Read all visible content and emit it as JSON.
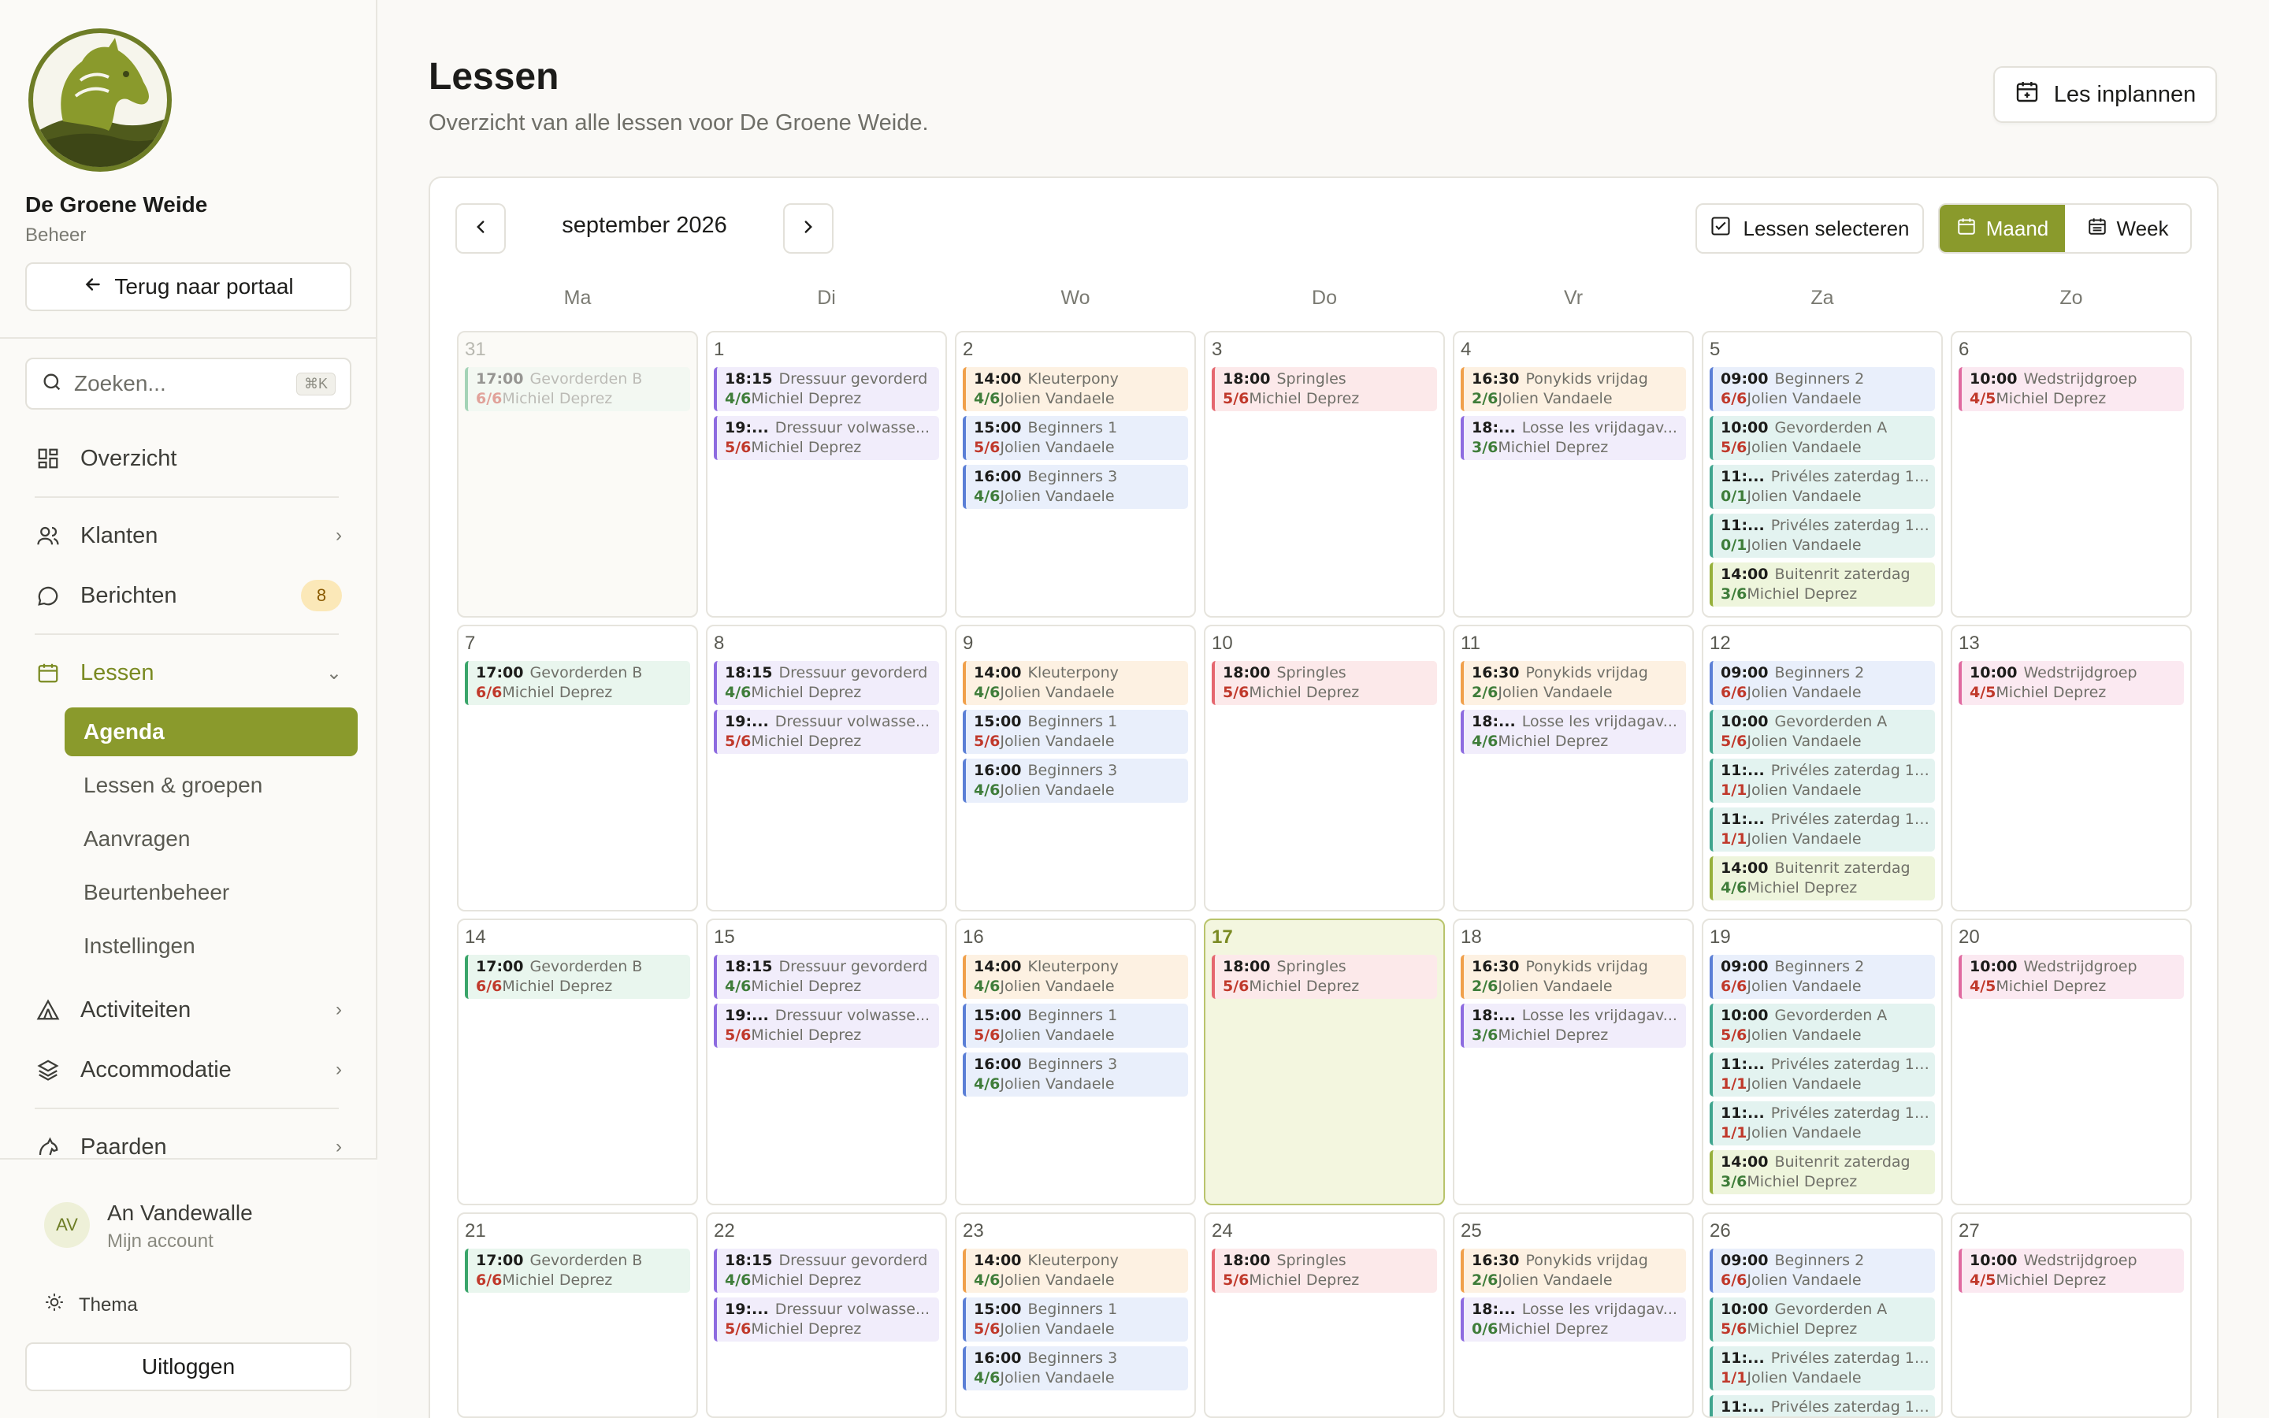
{
  "sidebar": {
    "brand_name": "De Groene Weide",
    "brand_sub": "Beheer",
    "back_label": "Terug naar portaal",
    "search_placeholder": "Zoeken...",
    "search_shortcut": "⌘K",
    "nav": {
      "overzicht": "Overzicht",
      "klanten": "Klanten",
      "berichten": "Berichten",
      "berichten_badge": "8",
      "lessen": "Lessen",
      "activiteiten": "Activiteiten",
      "accommodatie": "Accommodatie",
      "paarden": "Paarden"
    },
    "lessen_sub": {
      "agenda": "Agenda",
      "lessen_groepen": "Lessen & groepen",
      "aanvragen": "Aanvragen",
      "beurtenbeheer": "Beurtenbeheer",
      "instellingen": "Instellingen"
    },
    "user": {
      "initials": "AV",
      "name": "An Vandewalle",
      "sub": "Mijn account"
    },
    "theme_label": "Thema",
    "logout_label": "Uitloggen"
  },
  "header": {
    "title": "Lessen",
    "subtitle": "Overzicht van alle lessen voor De Groene Weide.",
    "plan_button": "Les inplannen"
  },
  "calendar": {
    "month_label": "september 2026",
    "select_button": "Lessen selecteren",
    "view_month": "Maand",
    "view_week": "Week",
    "active_view": "Maand",
    "weekdays": [
      "Ma",
      "Di",
      "Wo",
      "Do",
      "Vr",
      "Za",
      "Zo"
    ],
    "weeks": [
      [
        {
          "day": "31",
          "muted": true,
          "events": [
            {
              "time": "17:00",
              "title": "Gevorderden B",
              "cap": "6/6",
              "who": "Michiel Deprez",
              "color": "green"
            }
          ]
        },
        {
          "day": "1",
          "events": [
            {
              "time": "18:15",
              "title": "Dressuur gevorderd",
              "cap": "4/6",
              "who": "Michiel Deprez",
              "color": "purple"
            },
            {
              "time": "19:...",
              "title": "Dressuur volwasse...",
              "cap": "5/6",
              "who": "Michiel Deprez",
              "color": "purple-red"
            }
          ]
        },
        {
          "day": "2",
          "events": [
            {
              "time": "14:00",
              "title": "Kleuterpony",
              "cap": "4/6",
              "who": "Jolien Vandaele",
              "color": "orange"
            },
            {
              "time": "15:00",
              "title": "Beginners 1",
              "cap": "5/6",
              "who": "Jolien Vandaele",
              "color": "blue"
            },
            {
              "time": "16:00",
              "title": "Beginners 3",
              "cap": "4/6",
              "who": "Jolien Vandaele",
              "color": "bluegreen"
            }
          ]
        },
        {
          "day": "3",
          "events": [
            {
              "time": "18:00",
              "title": "Springles",
              "cap": "5/6",
              "who": "Michiel Deprez",
              "color": "red"
            }
          ]
        },
        {
          "day": "4",
          "events": [
            {
              "time": "16:30",
              "title": "Ponykids vrijdag",
              "cap": "2/6",
              "who": "Jolien Vandaele",
              "color": "orange"
            },
            {
              "time": "18:...",
              "title": "Losse les vrijdagav...",
              "cap": "3/6",
              "who": "Michiel Deprez",
              "color": "purple"
            }
          ]
        },
        {
          "day": "5",
          "events": [
            {
              "time": "09:00",
              "title": "Beginners 2",
              "cap": "6/6",
              "who": "Jolien Vandaele",
              "color": "blue"
            },
            {
              "time": "10:00",
              "title": "Gevorderden A",
              "cap": "5/6",
              "who": "Jolien Vandaele",
              "color": "teal-red"
            },
            {
              "time": "11:...",
              "title": "Privéles zaterdag 11...",
              "cap": "0/1",
              "who": "Jolien Vandaele",
              "color": "teal"
            },
            {
              "time": "11:...",
              "title": "Privéles zaterdag 11...",
              "cap": "0/1",
              "who": "Jolien Vandaele",
              "color": "teal"
            },
            {
              "time": "14:00",
              "title": "Buitenrit zaterdag",
              "cap": "3/6",
              "who": "Michiel Deprez",
              "color": "lime"
            }
          ]
        },
        {
          "day": "6",
          "events": [
            {
              "time": "10:00",
              "title": "Wedstrijdgroep",
              "cap": "4/5",
              "who": "Michiel Deprez",
              "color": "pink"
            }
          ]
        }
      ],
      [
        {
          "day": "7",
          "events": [
            {
              "time": "17:00",
              "title": "Gevorderden B",
              "cap": "6/6",
              "who": "Michiel Deprez",
              "color": "green"
            }
          ]
        },
        {
          "day": "8",
          "events": [
            {
              "time": "18:15",
              "title": "Dressuur gevorderd",
              "cap": "4/6",
              "who": "Michiel Deprez",
              "color": "purple"
            },
            {
              "time": "19:...",
              "title": "Dressuur volwasse...",
              "cap": "5/6",
              "who": "Michiel Deprez",
              "color": "purple-red"
            }
          ]
        },
        {
          "day": "9",
          "events": [
            {
              "time": "14:00",
              "title": "Kleuterpony",
              "cap": "4/6",
              "who": "Jolien Vandaele",
              "color": "orange"
            },
            {
              "time": "15:00",
              "title": "Beginners 1",
              "cap": "5/6",
              "who": "Jolien Vandaele",
              "color": "blue"
            },
            {
              "time": "16:00",
              "title": "Beginners 3",
              "cap": "4/6",
              "who": "Jolien Vandaele",
              "color": "bluegreen"
            }
          ]
        },
        {
          "day": "10",
          "events": [
            {
              "time": "18:00",
              "title": "Springles",
              "cap": "5/6",
              "who": "Michiel Deprez",
              "color": "red"
            }
          ]
        },
        {
          "day": "11",
          "events": [
            {
              "time": "16:30",
              "title": "Ponykids vrijdag",
              "cap": "2/6",
              "who": "Jolien Vandaele",
              "color": "orange"
            },
            {
              "time": "18:...",
              "title": "Losse les vrijdagav...",
              "cap": "4/6",
              "who": "Michiel Deprez",
              "color": "purple"
            }
          ]
        },
        {
          "day": "12",
          "events": [
            {
              "time": "09:00",
              "title": "Beginners 2",
              "cap": "6/6",
              "who": "Jolien Vandaele",
              "color": "blue"
            },
            {
              "time": "10:00",
              "title": "Gevorderden A",
              "cap": "5/6",
              "who": "Jolien Vandaele",
              "color": "teal-red"
            },
            {
              "time": "11:...",
              "title": "Privéles zaterdag 11...",
              "cap": "1/1",
              "who": "Jolien Vandaele",
              "color": "teal-red"
            },
            {
              "time": "11:...",
              "title": "Privéles zaterdag 11...",
              "cap": "1/1",
              "who": "Jolien Vandaele",
              "color": "teal-red"
            },
            {
              "time": "14:00",
              "title": "Buitenrit zaterdag",
              "cap": "4/6",
              "who": "Michiel Deprez",
              "color": "lime"
            }
          ]
        },
        {
          "day": "13",
          "events": [
            {
              "time": "10:00",
              "title": "Wedstrijdgroep",
              "cap": "4/5",
              "who": "Michiel Deprez",
              "color": "pink"
            }
          ]
        }
      ],
      [
        {
          "day": "14",
          "events": [
            {
              "time": "17:00",
              "title": "Gevorderden B",
              "cap": "6/6",
              "who": "Michiel Deprez",
              "color": "green"
            }
          ]
        },
        {
          "day": "15",
          "events": [
            {
              "time": "18:15",
              "title": "Dressuur gevorderd",
              "cap": "4/6",
              "who": "Michiel Deprez",
              "color": "purple"
            },
            {
              "time": "19:...",
              "title": "Dressuur volwasse...",
              "cap": "5/6",
              "who": "Michiel Deprez",
              "color": "purple-red"
            }
          ]
        },
        {
          "day": "16",
          "events": [
            {
              "time": "14:00",
              "title": "Kleuterpony",
              "cap": "4/6",
              "who": "Jolien Vandaele",
              "color": "orange"
            },
            {
              "time": "15:00",
              "title": "Beginners 1",
              "cap": "5/6",
              "who": "Jolien Vandaele",
              "color": "blue"
            },
            {
              "time": "16:00",
              "title": "Beginners 3",
              "cap": "4/6",
              "who": "Jolien Vandaele",
              "color": "bluegreen"
            }
          ]
        },
        {
          "day": "17",
          "today": true,
          "events": [
            {
              "time": "18:00",
              "title": "Springles",
              "cap": "5/6",
              "who": "Michiel Deprez",
              "color": "red"
            }
          ]
        },
        {
          "day": "18",
          "events": [
            {
              "time": "16:30",
              "title": "Ponykids vrijdag",
              "cap": "2/6",
              "who": "Jolien Vandaele",
              "color": "orange"
            },
            {
              "time": "18:...",
              "title": "Losse les vrijdagav...",
              "cap": "3/6",
              "who": "Michiel Deprez",
              "color": "purple"
            }
          ]
        },
        {
          "day": "19",
          "events": [
            {
              "time": "09:00",
              "title": "Beginners 2",
              "cap": "6/6",
              "who": "Jolien Vandaele",
              "color": "blue"
            },
            {
              "time": "10:00",
              "title": "Gevorderden A",
              "cap": "5/6",
              "who": "Jolien Vandaele",
              "color": "teal-red"
            },
            {
              "time": "11:...",
              "title": "Privéles zaterdag 11...",
              "cap": "1/1",
              "who": "Jolien Vandaele",
              "color": "teal-red"
            },
            {
              "time": "11:...",
              "title": "Privéles zaterdag 11...",
              "cap": "1/1",
              "who": "Jolien Vandaele",
              "color": "teal-red"
            },
            {
              "time": "14:00",
              "title": "Buitenrit zaterdag",
              "cap": "3/6",
              "who": "Michiel Deprez",
              "color": "lime"
            }
          ]
        },
        {
          "day": "20",
          "events": [
            {
              "time": "10:00",
              "title": "Wedstrijdgroep",
              "cap": "4/5",
              "who": "Michiel Deprez",
              "color": "pink"
            }
          ]
        }
      ],
      [
        {
          "day": "21",
          "events": [
            {
              "time": "17:00",
              "title": "Gevorderden B",
              "cap": "6/6",
              "who": "Michiel Deprez",
              "color": "green"
            }
          ]
        },
        {
          "day": "22",
          "events": [
            {
              "time": "18:15",
              "title": "Dressuur gevorderd",
              "cap": "4/6",
              "who": "Michiel Deprez",
              "color": "purple"
            },
            {
              "time": "19:...",
              "title": "Dressuur volwasse...",
              "cap": "5/6",
              "who": "Michiel Deprez",
              "color": "purple-red"
            }
          ]
        },
        {
          "day": "23",
          "events": [
            {
              "time": "14:00",
              "title": "Kleuterpony",
              "cap": "4/6",
              "who": "Jolien Vandaele",
              "color": "orange"
            },
            {
              "time": "15:00",
              "title": "Beginners 1",
              "cap": "5/6",
              "who": "Jolien Vandaele",
              "color": "blue"
            },
            {
              "time": "16:00",
              "title": "Beginners 3",
              "cap": "4/6",
              "who": "Jolien Vandaele",
              "color": "bluegreen"
            }
          ]
        },
        {
          "day": "24",
          "events": [
            {
              "time": "18:00",
              "title": "Springles",
              "cap": "5/6",
              "who": "Michiel Deprez",
              "color": "red"
            }
          ]
        },
        {
          "day": "25",
          "events": [
            {
              "time": "16:30",
              "title": "Ponykids vrijdag",
              "cap": "2/6",
              "who": "Jolien Vandaele",
              "color": "orange"
            },
            {
              "time": "18:...",
              "title": "Losse les vrijdagav...",
              "cap": "0/6",
              "who": "Michiel Deprez",
              "color": "purple"
            }
          ]
        },
        {
          "day": "26",
          "events": [
            {
              "time": "09:00",
              "title": "Beginners 2",
              "cap": "6/6",
              "who": "Jolien Vandaele",
              "color": "blue"
            },
            {
              "time": "10:00",
              "title": "Gevorderden A",
              "cap": "5/6",
              "who": "Michiel Deprez",
              "color": "teal-red"
            },
            {
              "time": "11:...",
              "title": "Privéles zaterdag 11...",
              "cap": "1/1",
              "who": "Jolien Vandaele",
              "color": "teal-red"
            },
            {
              "time": "11:...",
              "title": "Privéles zaterdag 11...",
              "cap": "",
              "who": "",
              "color": "teal"
            }
          ]
        },
        {
          "day": "27",
          "events": [
            {
              "time": "10:00",
              "title": "Wedstrijdgroep",
              "cap": "4/5",
              "who": "Michiel Deprez",
              "color": "pink"
            }
          ]
        }
      ]
    ]
  },
  "colors": {
    "accent": "#8a9a2c",
    "brand_green": "#6e7d26"
  }
}
